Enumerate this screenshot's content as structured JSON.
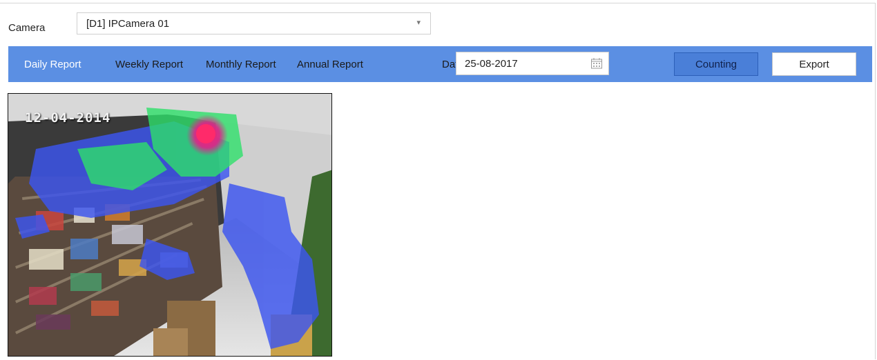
{
  "camera": {
    "label": "Camera",
    "selected": "[D1] IPCamera 01"
  },
  "tabs": [
    {
      "label": "Daily Report",
      "active": true
    },
    {
      "label": "Weekly Report",
      "active": false
    },
    {
      "label": "Monthly Report",
      "active": false
    },
    {
      "label": "Annual Report",
      "active": false
    }
  ],
  "date": {
    "label": "Date",
    "value": "25-08-2017"
  },
  "buttons": {
    "counting": "Counting",
    "export": "Export"
  },
  "video": {
    "timestamp": "12-04-2014"
  },
  "colors": {
    "toolbar": "#5b8fe3",
    "heat_low": "#3c55f0",
    "heat_mid": "#2ee06a",
    "heat_high": "#ff2a6a"
  }
}
